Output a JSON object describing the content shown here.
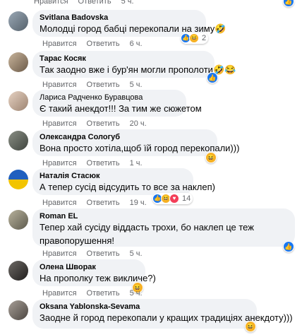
{
  "top": {
    "like": "Нравится",
    "reply": "Ответить",
    "time": "5 ч."
  },
  "comments": [
    {
      "author": "Svitlana Badovska",
      "lines": [
        "Молодці город бабці перекопали на зиму🤣"
      ],
      "like": "Нравится",
      "reply": "Ответить",
      "time": "6 ч.",
      "react_count": "2",
      "react_types": [
        "like-icon",
        "haha-icon"
      ]
    },
    {
      "author": "Тарас Косяк",
      "lines": [
        "Так заодно вже і бур'ян могли прополоти🤣😂"
      ],
      "like": "Нравится",
      "reply": "Ответить",
      "time": "5 ч.",
      "react_types": [
        "like-icon"
      ]
    },
    {
      "author": "Лариса Радченко Буравцова",
      "lines": [
        "Є такий анекдот!!! За тим же сюжетом"
      ],
      "like": "Нравится",
      "reply": "Ответить",
      "time": "20 ч."
    },
    {
      "author": "Олександра Сологуб",
      "lines": [
        "Вона просто хотіла,щоб їй город перекопали)))"
      ],
      "like": "Нравится",
      "reply": "Ответить",
      "time": "1 ч.",
      "react_types": [
        "haha-icon"
      ]
    },
    {
      "author": "Наталія Стасюк",
      "lines": [
        "А тепер сусід відсудить то все за наклеп)"
      ],
      "like": "Нравится",
      "reply": "Ответить",
      "time": "19 ч.",
      "react_count": "14",
      "react_types": [
        "like-icon",
        "haha-icon",
        "heart-icon"
      ]
    },
    {
      "author": "Roman EL",
      "lines": [
        "Тепер хай сусіду віддасть трохи, бо наклеп це теж",
        "правопорушення!"
      ],
      "like": "Нравится",
      "reply": "Ответить",
      "time": "5 ч.",
      "react_types": [
        "like-icon"
      ]
    },
    {
      "author": "Олена Шворак",
      "lines": [
        "На прополку теж викличе?)"
      ],
      "like": "Нравится",
      "reply": "Ответить",
      "time": "5 ч.",
      "react_types": [
        "haha-icon"
      ]
    },
    {
      "author": "Oksana Yablonska-Sevama",
      "lines": [
        "Заодне й город перекопали у кращих традиціях анекдоту)))"
      ],
      "react_types": [
        "haha-icon"
      ]
    }
  ],
  "colors": {
    "like": "#1877f2",
    "heart": "#f33e58",
    "haha": "#f7b125",
    "bubble": "#f0f2f5",
    "meta": "#65676b"
  }
}
